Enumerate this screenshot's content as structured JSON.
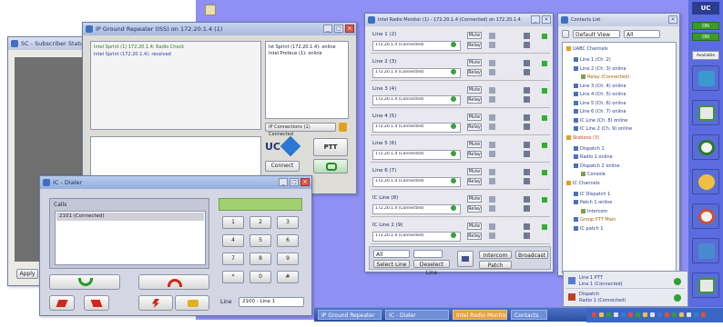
{
  "colors": {
    "desktop": "#8f8ff4",
    "accent_green": "#3aa040",
    "accent_red": "#cc2a1a",
    "taskbar": "#2b4f9e"
  },
  "left_window": {
    "title": "SC - Subscriber Status",
    "button": "Apply"
  },
  "chat_window": {
    "title": "IP Ground Repeater (ISS) on 172.20.1.4 (1)",
    "messages": [
      "Intel Sprint (1) 172.20.1.4: Radio Check",
      "Intel Sprint (172.20.1.4): received"
    ],
    "right_list": [
      "Ist Sprint (172.20.1.4): online",
      "Intel Proteus (1): online"
    ],
    "dropdown": "IP Connections (1) Connected",
    "ptt_label": "PTT",
    "logo_text": "UC",
    "left_button": "Connect",
    "radio_label": "Radio"
  },
  "dialer": {
    "title": "IC - Dialer",
    "calls_header": "Calls",
    "call_item": "2101 (Connected)",
    "keys": [
      "1",
      "2",
      "3",
      "4",
      "5",
      "6",
      "7",
      "8",
      "9",
      "*",
      "0",
      "#"
    ],
    "line_label": "Line",
    "line_value": "2100 - Line 1"
  },
  "monitor": {
    "title": "Intel Radio Monitor (1) - 172.20.1.4 (Connected) on 172.20.1.4",
    "rows": [
      {
        "name": "Line 1 (2)",
        "detail": "172.20.1.4 (Connected)",
        "btn1": "Mute",
        "btn2": "Relay"
      },
      {
        "name": "Line 2 (3)",
        "detail": "172.20.1.4 (Connected)",
        "btn1": "Mute",
        "btn2": "Relay"
      },
      {
        "name": "Line 3 (4)",
        "detail": "172.20.1.4 (Connected)",
        "btn1": "Mute",
        "btn2": "Relay"
      },
      {
        "name": "Line 4 (5)",
        "detail": "172.20.1.4 (Connected)",
        "btn1": "Mute",
        "btn2": "Relay"
      },
      {
        "name": "Line 5 (6)",
        "detail": "172.20.1.4 (Connected)",
        "btn1": "Mute",
        "btn2": "Relay"
      },
      {
        "name": "Line 6 (7)",
        "detail": "172.20.1.4 (Connected)",
        "btn1": "Mute",
        "btn2": "Relay"
      },
      {
        "name": "IC Line (8)",
        "detail": "172.20.1.4 (Connected)",
        "btn1": "Mute",
        "btn2": "Relay"
      },
      {
        "name": "IC Line 2 (9)",
        "detail": "172.20.1.4 (Connected)",
        "btn1": "Mute",
        "btn2": "Relay"
      }
    ],
    "bottom": {
      "select_label": "All",
      "btn_a": "Select Line",
      "btn_b": "Deselect Line",
      "btn_c": "Patch",
      "btn_d": "Intercom",
      "btn_e": "Broadcast"
    }
  },
  "contacts": {
    "title": "Contacts List",
    "filter_label": "Default View",
    "filter_select": "All",
    "tree": [
      {
        "level": 0,
        "text": "UABC Channels",
        "color": "#2a3a8a"
      },
      {
        "level": 1,
        "text": "Line 1 (Ch. 2)",
        "color": "#2a3a8a"
      },
      {
        "level": 1,
        "text": "Line 2 (Ch. 3) online",
        "color": "#2a3a8a"
      },
      {
        "level": 2,
        "text": "Relay (Connected)",
        "color": "#a06010"
      },
      {
        "level": 1,
        "text": "Line 3 (Ch. 4) online",
        "color": "#2a3a8a"
      },
      {
        "level": 1,
        "text": "Line 4 (Ch. 5) online",
        "color": "#2a3a8a"
      },
      {
        "level": 1,
        "text": "Line 5 (Ch. 6) online",
        "color": "#2a3a8a"
      },
      {
        "level": 1,
        "text": "Line 6 (Ch. 7) online",
        "color": "#2a3a8a"
      },
      {
        "level": 1,
        "text": "IC Line (Ch. 8) online",
        "color": "#2a3a8a"
      },
      {
        "level": 1,
        "text": "IC Line 2 (Ch. 9) online",
        "color": "#2a3a8a"
      },
      {
        "level": 0,
        "text": "Stations (3)",
        "color": "#c04020"
      },
      {
        "level": 1,
        "text": "Dispatch 1",
        "color": "#2a3a8a"
      },
      {
        "level": 1,
        "text": "Radio 1 online",
        "color": "#2a3a8a"
      },
      {
        "level": 1,
        "text": "Dispatch 2 online",
        "color": "#2a3a8a"
      },
      {
        "level": 2,
        "text": "Console",
        "color": "#2a3a8a"
      },
      {
        "level": 0,
        "text": "IC Channels",
        "color": "#2a3a8a"
      },
      {
        "level": 1,
        "text": "IC Dispatch 1",
        "color": "#2a3a8a"
      },
      {
        "level": 1,
        "text": "Patch 1 online",
        "color": "#2a3a8a"
      },
      {
        "level": 2,
        "text": "Intercom",
        "color": "#2a3a8a"
      },
      {
        "level": 1,
        "text": "Group PTT Main",
        "color": "#a06010"
      },
      {
        "level": 1,
        "text": "IC patch 1",
        "color": "#2a3a8a"
      }
    ]
  },
  "notifications": [
    {
      "name": "Line 1 PTT",
      "detail": "Line 1 (Connected)"
    },
    {
      "name": "Dispatch",
      "detail": "Radio 1 (Connected)"
    }
  ],
  "sidebar": {
    "top_label": "UC",
    "badge_a": "ON",
    "badge_b": "ON",
    "badge_c": "Available"
  },
  "taskbar": {
    "items": [
      "IP Ground Repeater",
      "IC - Dialer",
      "Intel Radio Monitor",
      "Contacts"
    ]
  }
}
